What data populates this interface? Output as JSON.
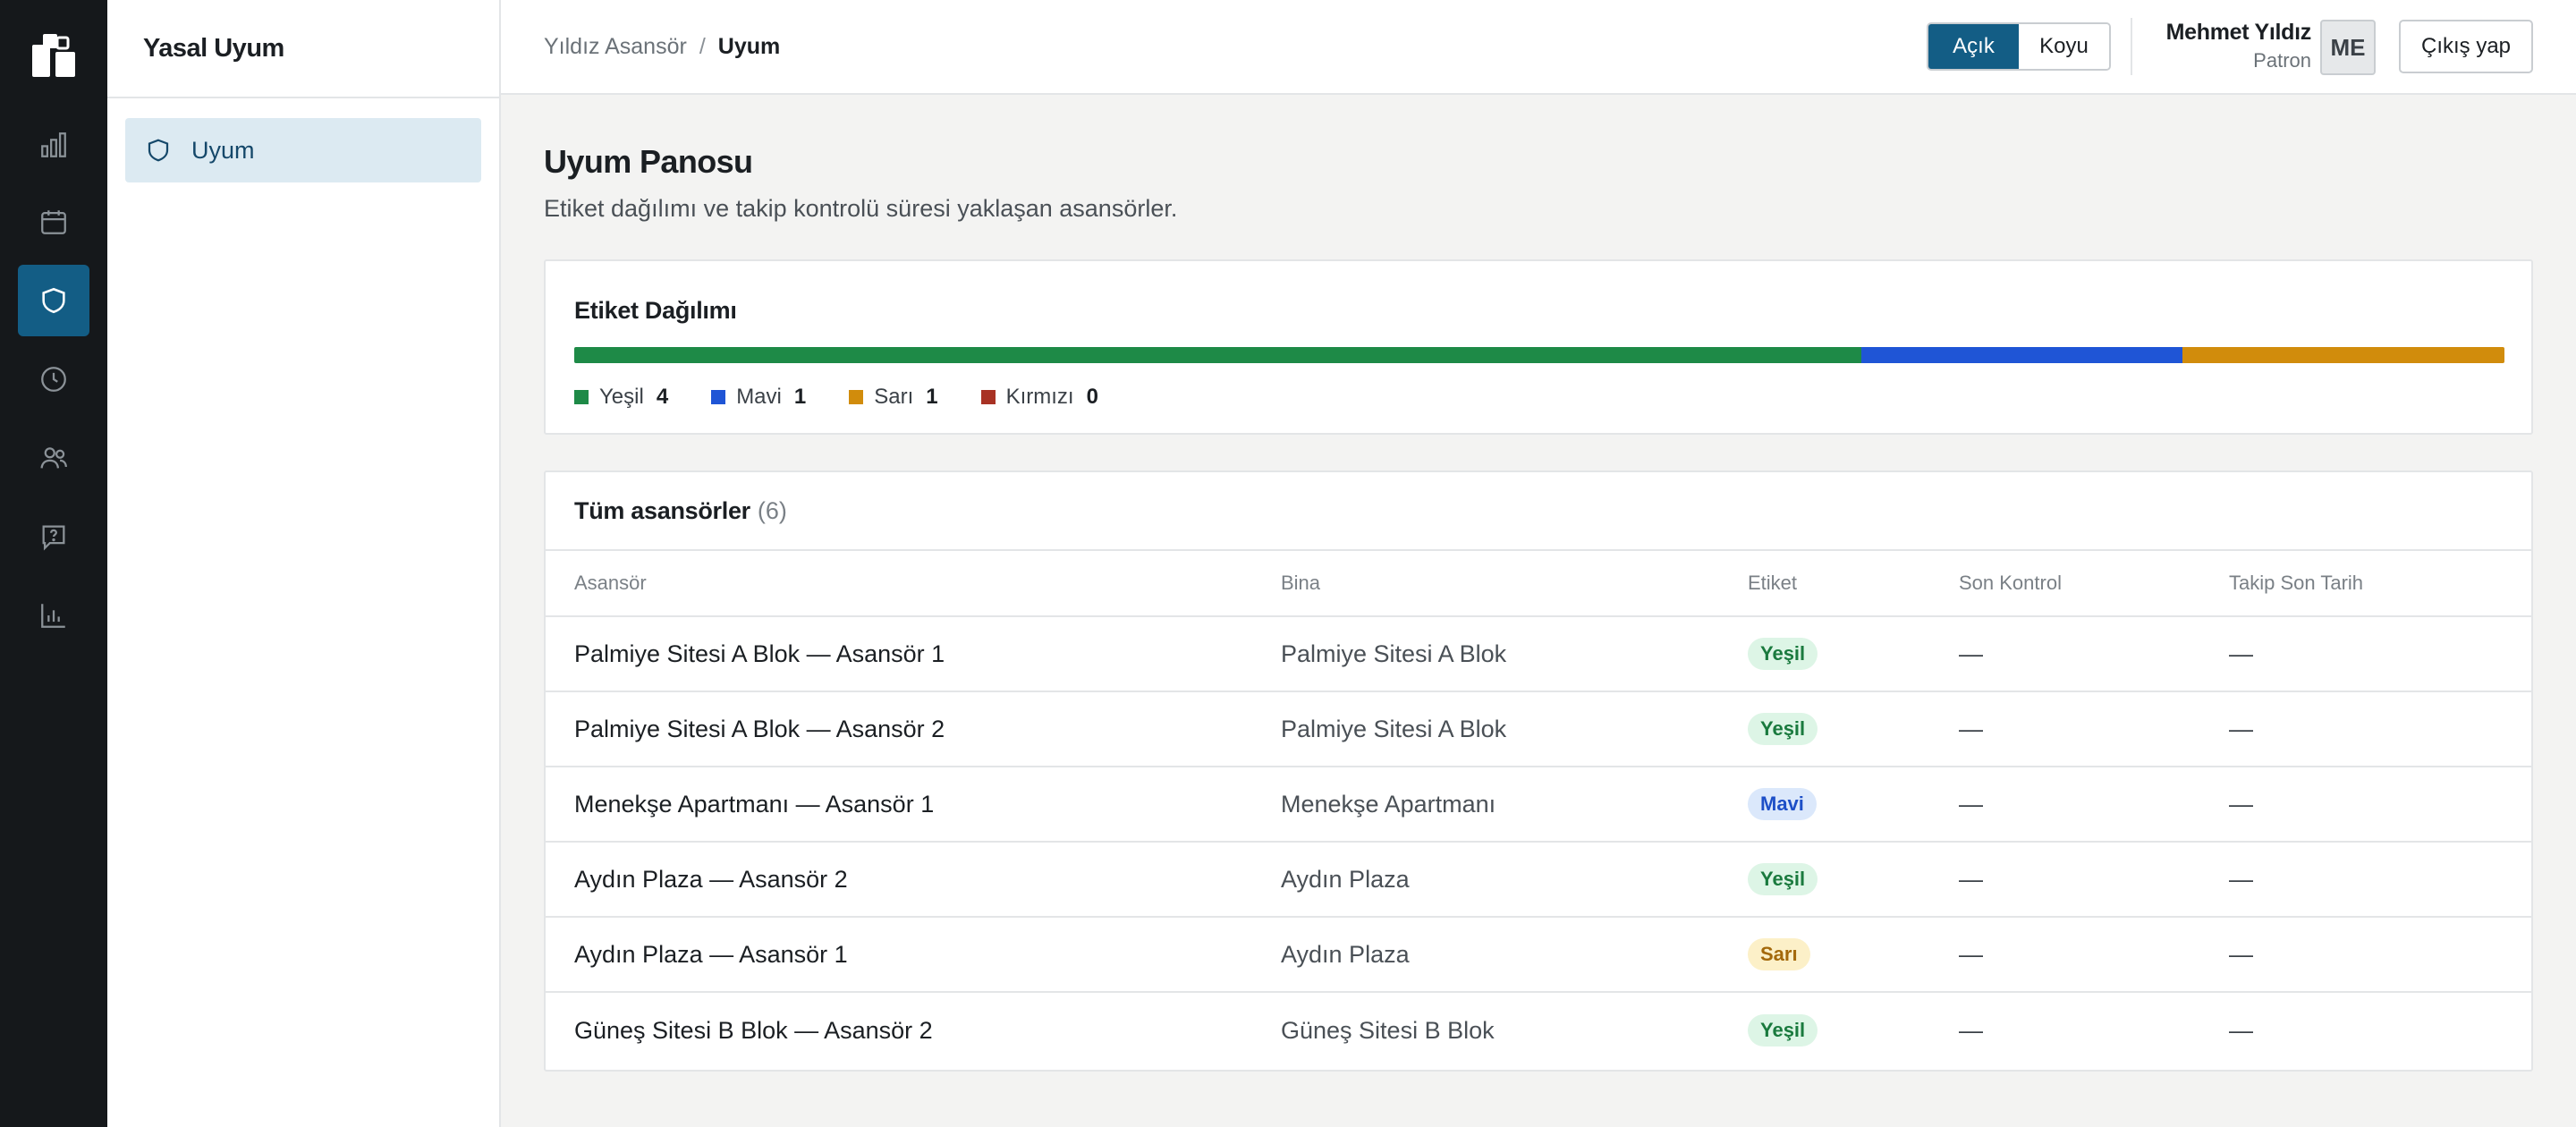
{
  "rail": {
    "items": [
      {
        "icon": "bar-chart-icon",
        "active": false
      },
      {
        "icon": "calendar-icon",
        "active": false
      },
      {
        "icon": "shield-icon",
        "active": true
      },
      {
        "icon": "clock-icon",
        "active": false
      },
      {
        "icon": "users-icon",
        "active": false
      },
      {
        "icon": "help-icon",
        "active": false
      },
      {
        "icon": "analytics-icon",
        "active": false
      }
    ]
  },
  "sidebar": {
    "title": "Yasal Uyum",
    "items": [
      {
        "label": "Uyum",
        "icon": "shield-icon",
        "active": true
      }
    ]
  },
  "header": {
    "breadcrumb": {
      "parent": "Yıldız Asansör",
      "separator": "/",
      "current": "Uyum"
    },
    "theme": {
      "light_label": "Açık",
      "dark_label": "Koyu",
      "selected": "Açık"
    },
    "user": {
      "name": "Mehmet Yıldız",
      "role": "Patron",
      "initials": "ME"
    },
    "logout_label": "Çıkış yap"
  },
  "page": {
    "title": "Uyum Panosu",
    "subtitle": "Etiket dağılımı ve takip kontrolü süresi yaklaşan asansörler."
  },
  "distribution": {
    "title": "Etiket Dağılımı",
    "items": [
      {
        "label": "Yeşil",
        "count": "4",
        "color": "#1e8a47"
      },
      {
        "label": "Mavi",
        "count": "1",
        "color": "#1f55d6"
      },
      {
        "label": "Sarı",
        "count": "1",
        "color": "#d18c0c"
      },
      {
        "label": "Kırmızı",
        "count": "0",
        "color": "#a83224"
      }
    ]
  },
  "table": {
    "title": "Tüm asansörler",
    "count": "(6)",
    "columns": [
      "Asansör",
      "Bina",
      "Etiket",
      "Son Kontrol",
      "Takip Son Tarih"
    ],
    "rows": [
      {
        "asansor": "Palmiye Sitesi A Blok — Asansör 1",
        "bina": "Palmiye Sitesi A Blok",
        "etiket": "Yeşil",
        "son_kontrol": "—",
        "takip": "—"
      },
      {
        "asansor": "Palmiye Sitesi A Blok — Asansör 2",
        "bina": "Palmiye Sitesi A Blok",
        "etiket": "Yeşil",
        "son_kontrol": "—",
        "takip": "—"
      },
      {
        "asansor": "Menekşe Apartmanı — Asansör 1",
        "bina": "Menekşe Apartmanı",
        "etiket": "Mavi",
        "son_kontrol": "—",
        "takip": "—"
      },
      {
        "asansor": "Aydın Plaza — Asansör 2",
        "bina": "Aydın Plaza",
        "etiket": "Yeşil",
        "son_kontrol": "—",
        "takip": "—"
      },
      {
        "asansor": "Aydın Plaza — Asansör 1",
        "bina": "Aydın Plaza",
        "etiket": "Sarı",
        "son_kontrol": "—",
        "takip": "—"
      },
      {
        "asansor": "Güneş Sitesi B Blok — Asansör 2",
        "bina": "Güneş Sitesi B Blok",
        "etiket": "Yeşil",
        "son_kontrol": "—",
        "takip": "—"
      }
    ]
  }
}
